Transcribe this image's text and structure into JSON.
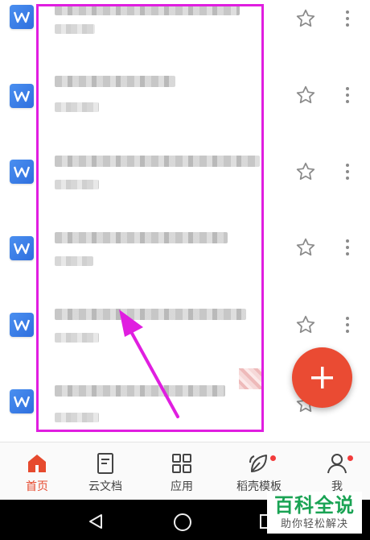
{
  "file_list": {
    "items": [
      {
        "type": "wps-writer-doc",
        "name": "",
        "meta": ""
      },
      {
        "type": "wps-writer-doc",
        "name": "",
        "meta": ""
      },
      {
        "type": "wps-writer-doc",
        "name": "",
        "meta": ""
      },
      {
        "type": "wps-writer-doc",
        "name": "",
        "meta": ""
      },
      {
        "type": "wps-writer-doc",
        "name": "",
        "meta": ""
      },
      {
        "type": "wps-writer-doc",
        "name": "",
        "meta": ""
      }
    ]
  },
  "fab": {
    "icon": "plus-icon",
    "color": "#ea4b33"
  },
  "bottom_nav": {
    "items": [
      {
        "label": "首页",
        "icon": "home-icon",
        "active": true
      },
      {
        "label": "云文档",
        "icon": "cloud-doc-icon",
        "active": false
      },
      {
        "label": "应用",
        "icon": "apps-grid-icon",
        "active": false
      },
      {
        "label": "稻壳模板",
        "icon": "leaf-icon",
        "active": false,
        "badge": true
      },
      {
        "label": "我",
        "icon": "person-icon",
        "active": false,
        "badge": true
      }
    ]
  },
  "watermark": {
    "title": "百科全说",
    "subtitle": "助你轻松解决"
  },
  "colors": {
    "accent": "#e64a2e",
    "highlight": "#e01ee0",
    "wps_blue": "#2f6fde"
  }
}
